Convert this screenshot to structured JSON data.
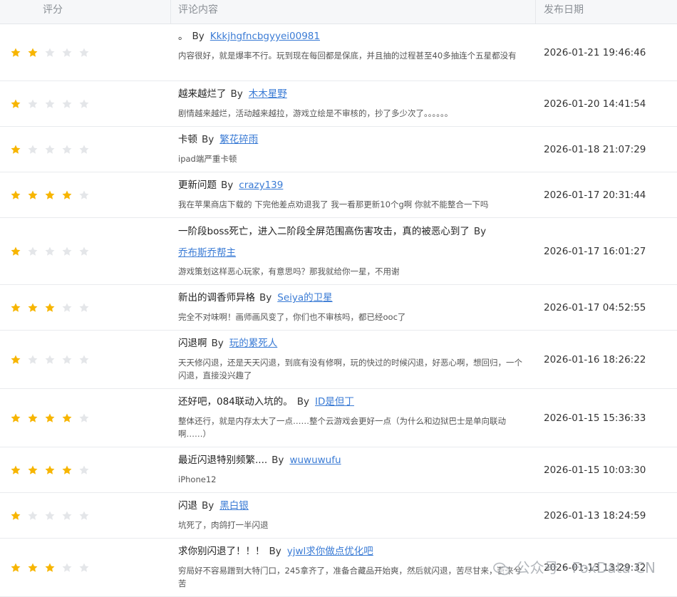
{
  "header": {
    "rating": "评分",
    "content": "评论内容",
    "date": "发布日期"
  },
  "by_label": "By",
  "colors": {
    "star_filled": "#f7b500",
    "star_empty": "#e4e6e9",
    "link": "#3a7bd5"
  },
  "rows": [
    {
      "stars": 2,
      "title": "。",
      "author": "Kkkjhgfncbgyyei00981",
      "body": "内容很好，就是爆率不行。玩到现在每回都是保底，并且抽的过程甚至40多抽连个五星都没有",
      "date": "2026-01-21 19:46:46"
    },
    {
      "stars": 1,
      "title": "越来越烂了",
      "author": "木木星野",
      "body": "剧情越来越烂，活动越来越拉，游戏立绘是不审核的，抄了多少次了。。。。。。",
      "date": "2026-01-20 14:41:54"
    },
    {
      "stars": 1,
      "title": "卡顿",
      "author": "繁花碎雨",
      "body": "ipad端严重卡顿",
      "date": "2026-01-18 21:07:29"
    },
    {
      "stars": 4,
      "title": "更新问题",
      "author": "crazy139",
      "body": "我在苹果商店下载的 下完他差点劝退我了 我一看那更新10个g啊 你就不能整合一下吗",
      "date": "2026-01-17 20:31:44"
    },
    {
      "stars": 1,
      "title": "一阶段boss死亡，进入二阶段全屏范围高伤害攻击，真的被恶心到了",
      "author": "乔布斯乔帮主",
      "body": "游戏策划这样恶心玩家，有意思吗？那我就给你一星，不用谢",
      "date": "2026-01-17 16:01:27"
    },
    {
      "stars": 3,
      "title": "新出的调香师异格",
      "author": "Seiya的卫星",
      "body": "完全不对味啊！画师画风变了，你们也不审核吗，都已经ooc了",
      "date": "2026-01-17 04:52:55"
    },
    {
      "stars": 1,
      "title": "闪退啊",
      "author": "玩的累死人",
      "body": "天天修闪退，还是天天闪退，到底有没有修啊，玩的快过的时候闪退，好恶心啊，想回归，一个闪退，直接没兴趣了",
      "date": "2026-01-16 18:26:22"
    },
    {
      "stars": 4,
      "title": "还好吧，084联动入坑的。",
      "author": "ID是但丁",
      "body": "整体还行，就是内存太大了一点……整个云游戏会更好一点（为什么和边狱巴士是单向联动啊……）",
      "date": "2026-01-15 15:36:33"
    },
    {
      "stars": 4,
      "title": "最近闪退特别频繁....",
      "author": "wuwuwufu",
      "body": "iPhone12",
      "date": "2026-01-15 10:03:30"
    },
    {
      "stars": 1,
      "title": "闪退",
      "author": "黑白银",
      "body": "坑死了，肉鸽打一半闪退",
      "date": "2026-01-13 18:24:59"
    },
    {
      "stars": 3,
      "title": "求你别闪退了！！！",
      "author": "yjwl求你做点优化吧",
      "body": "穷局好不容易蹭到大特门口，245拿齐了，准备合藏品开始爽，然后就闪退，苦尽甘来，苦来兮苦",
      "date": "2026-01-13 13:29:32"
    }
  ],
  "watermark": {
    "text": "公众号 · FoxData CN",
    "icon": "wechat-icon"
  }
}
